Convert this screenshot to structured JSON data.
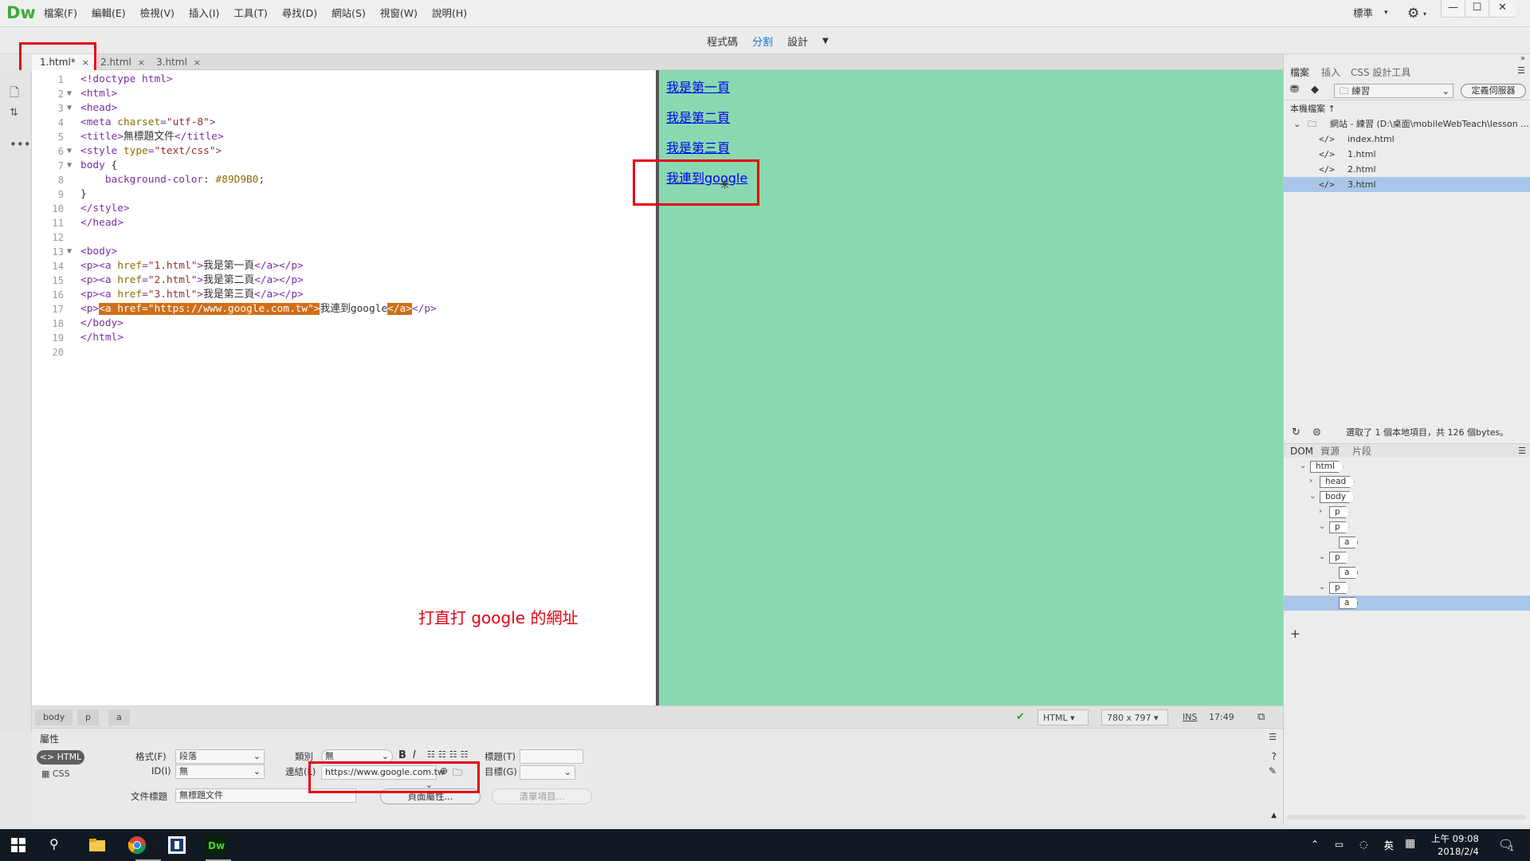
{
  "app": {
    "logo": "Dw",
    "menus": [
      "檔案(F)",
      "編輯(E)",
      "檢視(V)",
      "插入(I)",
      "工具(T)",
      "尋找(D)",
      "網站(S)",
      "視窗(W)",
      "說明(H)"
    ],
    "workspace": "標準",
    "window_controls": [
      "—",
      "☐",
      "✕"
    ]
  },
  "viewbar": {
    "code": "程式碼",
    "split": "分割",
    "design": "設計"
  },
  "tabs": [
    {
      "label": "1.html*",
      "close": "×"
    },
    {
      "label": "2.html",
      "close": "×"
    },
    {
      "label": "3.html",
      "close": "×"
    }
  ],
  "code": {
    "line_numbers": [
      "1",
      "2",
      "3",
      "4",
      "5",
      "6",
      "7",
      "8",
      "9",
      "10",
      "11",
      "12",
      "13",
      "14",
      "15",
      "16",
      "17",
      "18",
      "19",
      "20"
    ],
    "annotation": "打直打 google 的網址"
  },
  "design": {
    "links": [
      "我是第一頁",
      "我是第二頁",
      "我是第三頁",
      "我連到google"
    ]
  },
  "doc_status": {
    "crumbs": [
      "body",
      "p",
      "a"
    ],
    "doctype": "HTML",
    "size": "780 x 797",
    "ins": "INS",
    "pos": "17:49"
  },
  "props": {
    "title": "屬性",
    "html_btn": "HTML",
    "css_btn": "CSS",
    "format_label": "格式(F)",
    "format_value": "段落",
    "class_label": "類別",
    "class_value": "無",
    "id_label": "ID(I)",
    "id_value": "無",
    "link_label": "連結(L)",
    "link_value": "https://www.google.com.tw",
    "title_label": "標題(T)",
    "target_label": "目標(G)",
    "doc_title_label": "文件標題",
    "doc_title_value": "無標題文件",
    "page_props": "頁面屬性...",
    "list_item": "清單項目..."
  },
  "files_panel": {
    "tabs": [
      "檔案",
      "插入",
      "CSS 設計工具"
    ],
    "site": "練習",
    "define_server": "定義伺服器",
    "local_files": "本機檔案 ↑",
    "root": "網站 - 練習 (D:\\桌面\\mobileWebTeach\\lesson ...",
    "files": [
      "index.html",
      "1.html",
      "2.html",
      "3.html"
    ],
    "status": "選取了 1 個本地項目，共 126 個bytes。"
  },
  "dom_panel": {
    "tabs": [
      "DOM",
      "資源",
      "片段"
    ],
    "nodes": [
      {
        "tag": "html",
        "depth": 0,
        "arrow": "⌄"
      },
      {
        "tag": "head",
        "depth": 1,
        "arrow": "›"
      },
      {
        "tag": "body",
        "depth": 1,
        "arrow": "⌄"
      },
      {
        "tag": "p",
        "depth": 2,
        "arrow": "›"
      },
      {
        "tag": "p",
        "depth": 2,
        "arrow": "⌄"
      },
      {
        "tag": "a",
        "depth": 3,
        "arrow": ""
      },
      {
        "tag": "p",
        "depth": 2,
        "arrow": "⌄"
      },
      {
        "tag": "a",
        "depth": 3,
        "arrow": ""
      },
      {
        "tag": "p",
        "depth": 2,
        "arrow": "⌄"
      },
      {
        "tag": "a",
        "depth": 3,
        "arrow": ""
      }
    ]
  },
  "taskbar": {
    "time": "上午 09:08",
    "date": "2018/2/4",
    "ime": "英",
    "notif": "1"
  },
  "colors": {
    "design_bg": "#89D9B0",
    "highlight": "#d06e19",
    "accent": "#1478d4",
    "annotation": "#e60012"
  }
}
